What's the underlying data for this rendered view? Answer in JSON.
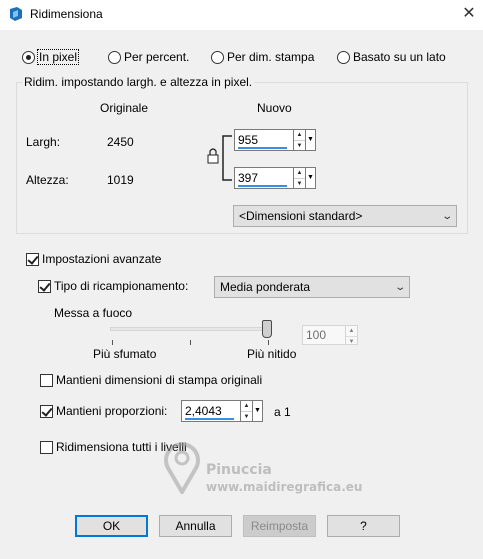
{
  "window": {
    "title": "Ridimensiona",
    "close_icon": "close-icon"
  },
  "mode_radios": [
    {
      "label": "In pixel",
      "checked": true
    },
    {
      "label": "Per percent.",
      "checked": false
    },
    {
      "label": "Per dim. stampa",
      "checked": false
    },
    {
      "label": "Basato su un lato",
      "checked": false
    }
  ],
  "dimensions": {
    "group_label": "Ridim. impostando largh. e altezza in pixel.",
    "original_header": "Originale",
    "new_header": "Nuovo",
    "width_label": "Largh:",
    "width_original": "2450",
    "width_new": "955",
    "height_label": "Altezza:",
    "height_original": "1019",
    "height_new": "397",
    "lock_icon": "lock-icon",
    "standard_sizes": "<Dimensioni standard>"
  },
  "advanced": {
    "label": "Impostazioni avanzate",
    "checked": true,
    "resample_label": "Tipo di ricampionamento:",
    "resample_checked": true,
    "resample_value": "Media ponderata",
    "sharpen_label": "Messa a fuoco",
    "sharpen_value": "100",
    "slider_level_percent": 100,
    "soft_label": "Più sfumato",
    "sharp_label": "Più nitido",
    "keep_print_label": "Mantieni dimensioni di stampa originali",
    "keep_print_checked": false,
    "keep_ratio_label": "Mantieni proporzioni:",
    "keep_ratio_checked": true,
    "ratio_value": "2,4043",
    "ratio_suffix": "a 1",
    "resize_all_label": "Ridimensiona tutti i livelli",
    "resize_all_checked": false
  },
  "buttons": {
    "ok": "OK",
    "cancel": "Annulla",
    "reset": "Reimposta",
    "help": "?"
  },
  "watermark": {
    "line1": "Pinuccia",
    "line2": "www.maidiregrafica.eu"
  },
  "colors": {
    "accent": "#0078d7",
    "input_underline": "#3a8ee6",
    "dialog_bg": "#f0f0f0"
  }
}
